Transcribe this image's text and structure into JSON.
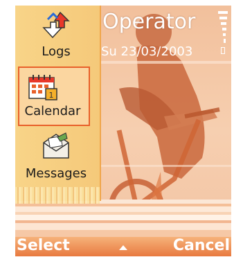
{
  "status": {
    "operator": "Operator",
    "date": "Su 23/03/2003"
  },
  "menu": {
    "items": [
      {
        "label": "Logs",
        "icon": "logs-icon",
        "selected": false
      },
      {
        "label": "Calendar",
        "icon": "calendar-icon",
        "selected": true
      },
      {
        "label": "Messages",
        "icon": "messages-icon",
        "selected": false
      }
    ]
  },
  "softkeys": {
    "left": "Select",
    "right": "Cancel"
  },
  "colors": {
    "accent": "#e8602a",
    "panel": "#f8d488",
    "softkey_bar": "#ee8a4c"
  }
}
